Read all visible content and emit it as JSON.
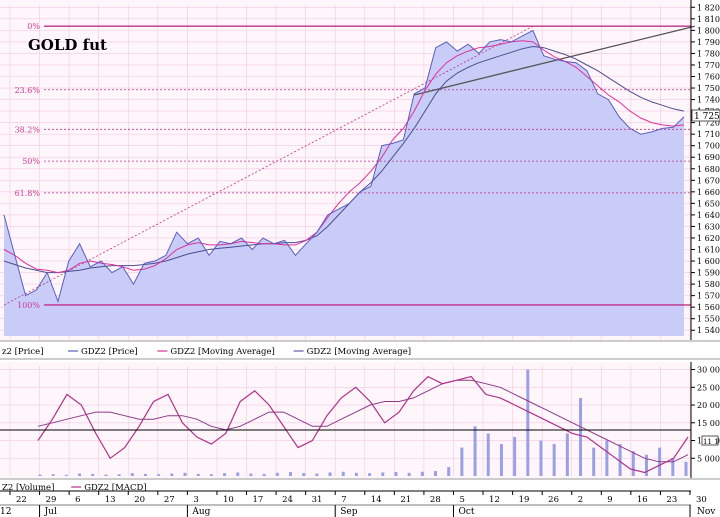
{
  "chart_data": [
    {
      "type": "line",
      "title": "GOLD fut",
      "ylim": [
        1535,
        1822
      ],
      "y_ticks": [
        1540,
        1550,
        1560,
        1570,
        1580,
        1590,
        1600,
        1610,
        1620,
        1630,
        1640,
        1650,
        1660,
        1670,
        1680,
        1690,
        1700,
        1710,
        1720,
        1730,
        1740,
        1750,
        1760,
        1770,
        1780,
        1790,
        1800,
        1810,
        1820
      ],
      "y_tick_labels": [
        "1 540",
        "1 550",
        "1 560",
        "1 570",
        "1 580",
        "1 590",
        "1 600",
        "1 610",
        "1 620",
        "1 630",
        "1 640",
        "1 650",
        "1 660",
        "1 670",
        "1 680",
        "1 690",
        "1 700",
        "1 710",
        "1 720",
        "1 730",
        "1 740",
        "1 750",
        "1 760",
        "1 770",
        "1 780",
        "1 790",
        "1 800",
        "1 810",
        "1 820"
      ],
      "last_price_label": "1 725",
      "fibonacci": [
        {
          "label": "0%",
          "value": 1803.6
        },
        {
          "label": "23.6%",
          "value": 1748.5
        },
        {
          "label": "38.2%",
          "value": 1714.2
        },
        {
          "label": "50%",
          "value": 1686.6
        },
        {
          "label": "61.8%",
          "value": 1659.1
        },
        {
          "label": "100%",
          "value": 1561.9
        }
      ],
      "legend": [
        {
          "label": "z2 [Price]"
        },
        {
          "label": "GDZ2 [Price]"
        },
        {
          "label": "GDZ2 [Moving Average]",
          "color": "#e0309a"
        },
        {
          "label": "GDZ2 [Moving Average]",
          "color": "#6a5aa8"
        }
      ],
      "price_series": [
        1640,
        1605,
        1570,
        1575,
        1590,
        1565,
        1600,
        1615,
        1595,
        1600,
        1590,
        1595,
        1580,
        1598,
        1600,
        1605,
        1625,
        1615,
        1620,
        1605,
        1617,
        1615,
        1620,
        1610,
        1620,
        1615,
        1618,
        1605,
        1615,
        1625,
        1640,
        1645,
        1650,
        1660,
        1665,
        1700,
        1702,
        1705,
        1745,
        1750,
        1785,
        1790,
        1782,
        1788,
        1780,
        1790,
        1792,
        1790,
        1795,
        1800,
        1778,
        1775,
        1773,
        1772,
        1765,
        1745,
        1740,
        1725,
        1715,
        1710,
        1712,
        1715,
        1716,
        1725
      ],
      "ma_fast": [
        1610,
        1605,
        1598,
        1593,
        1592,
        1590,
        1592,
        1598,
        1600,
        1598,
        1597,
        1595,
        1592,
        1593,
        1596,
        1602,
        1610,
        1614,
        1616,
        1614,
        1614,
        1615,
        1617,
        1616,
        1615,
        1615,
        1614,
        1614,
        1618,
        1625,
        1638,
        1650,
        1660,
        1668,
        1678,
        1690,
        1705,
        1715,
        1730,
        1748,
        1762,
        1772,
        1778,
        1782,
        1785,
        1786,
        1788,
        1790,
        1791,
        1790,
        1783,
        1777,
        1773,
        1768,
        1760,
        1752,
        1744,
        1738,
        1730,
        1724,
        1720,
        1718,
        1717,
        1718
      ],
      "ma_slow": [
        1600,
        1597,
        1594,
        1592,
        1590,
        1590,
        1591,
        1592,
        1594,
        1595,
        1596,
        1596,
        1596,
        1597,
        1598,
        1600,
        1603,
        1606,
        1608,
        1610,
        1611,
        1612,
        1613,
        1614,
        1615,
        1615,
        1616,
        1616,
        1618,
        1622,
        1630,
        1640,
        1650,
        1660,
        1668,
        1678,
        1690,
        1702,
        1715,
        1730,
        1745,
        1756,
        1763,
        1768,
        1772,
        1775,
        1778,
        1781,
        1784,
        1786,
        1785,
        1782,
        1779,
        1775,
        1770,
        1765,
        1759,
        1753,
        1747,
        1742,
        1738,
        1735,
        1732,
        1730
      ],
      "trendlines": [
        {
          "from": [
            0,
            1561.9
          ],
          "to": [
            49,
            1803.6
          ],
          "style": "dashed"
        },
        {
          "from": [
            38,
            1744
          ],
          "to": [
            64,
            1803.6
          ],
          "style": "solid"
        }
      ]
    },
    {
      "type": "line",
      "ylim": [
        0,
        31000
      ],
      "y_ticks": [
        5000,
        10000,
        15000,
        20000,
        25000,
        30000
      ],
      "y_tick_labels": [
        "5 000",
        "10 000",
        "15 000",
        "20 000",
        "25 000",
        "30 000"
      ],
      "last_value_label": "11 1",
      "legend": [
        {
          "label": "Z2 [Volume]"
        },
        {
          "label": "GDZ2 [MACD]",
          "color": "#b0308a"
        }
      ],
      "macd_series": [
        10000,
        16000,
        23000,
        20000,
        12000,
        5000,
        8000,
        14000,
        21000,
        23000,
        15000,
        11000,
        9000,
        12000,
        21000,
        24000,
        20000,
        14000,
        8000,
        10000,
        17000,
        22000,
        25000,
        21000,
        15000,
        18000,
        24000,
        28000,
        26000,
        27000,
        28000,
        23000,
        22000,
        20000,
        18000,
        16000,
        14000,
        12000,
        11000,
        8000,
        5000,
        2000,
        1000,
        3000,
        5000,
        11000
      ],
      "signal_series": [
        14000,
        15000,
        16000,
        17000,
        18000,
        18000,
        17000,
        16000,
        16000,
        17000,
        17000,
        16000,
        14000,
        13000,
        14000,
        16000,
        18000,
        18000,
        16000,
        14000,
        14000,
        16000,
        18000,
        20000,
        21000,
        21000,
        22000,
        24000,
        26000,
        27000,
        27000,
        26000,
        25000,
        23000,
        21000,
        19000,
        17000,
        15000,
        13000,
        11000,
        9000,
        7000,
        5000,
        4000,
        4000,
        6000
      ],
      "volume_series": [
        400,
        500,
        300,
        700,
        600,
        400,
        500,
        800,
        600,
        500,
        700,
        900,
        600,
        500,
        800,
        1000,
        700,
        600,
        900,
        1100,
        800,
        700,
        1000,
        1200,
        900,
        800,
        1000,
        1100,
        900,
        1200,
        1400,
        2500,
        8000,
        14000,
        12000,
        9000,
        11000,
        30000,
        10000,
        9000,
        12000,
        22000,
        8000,
        10000,
        9000,
        7000,
        6000,
        8000,
        5000,
        4000
      ],
      "volume_color": "#9aa0e6"
    }
  ],
  "x_axis": {
    "day_labels": [
      "22",
      "29",
      "6",
      "13",
      "20",
      "27",
      "3",
      "10",
      "17",
      "24",
      "31",
      "7",
      "14",
      "21",
      "28",
      "5",
      "12",
      "19",
      "26",
      "2",
      "9",
      "16",
      "23",
      "30"
    ],
    "month_labels": [
      {
        "label": "Jul",
        "index": 1
      },
      {
        "label": "Aug",
        "index": 6
      },
      {
        "label": "Sep",
        "index": 11
      },
      {
        "label": "Oct",
        "index": 15
      },
      {
        "label": "Nov",
        "index": 23
      }
    ],
    "edge_label": "12",
    "bottom_right_label": "Nov"
  },
  "colors": {
    "background": "#ffffff",
    "plot_bg": "#fff6fb",
    "grid": "#f3c7df",
    "area_fill": "#c8ccf7",
    "price_line": "#5a5fbf",
    "ma_fast": "#e0309a",
    "ma_slow": "#4a4f90",
    "fib_line": "#c0308a",
    "fib_text": "#d03a96",
    "trend_line": "#555555",
    "axis": "#000000"
  }
}
